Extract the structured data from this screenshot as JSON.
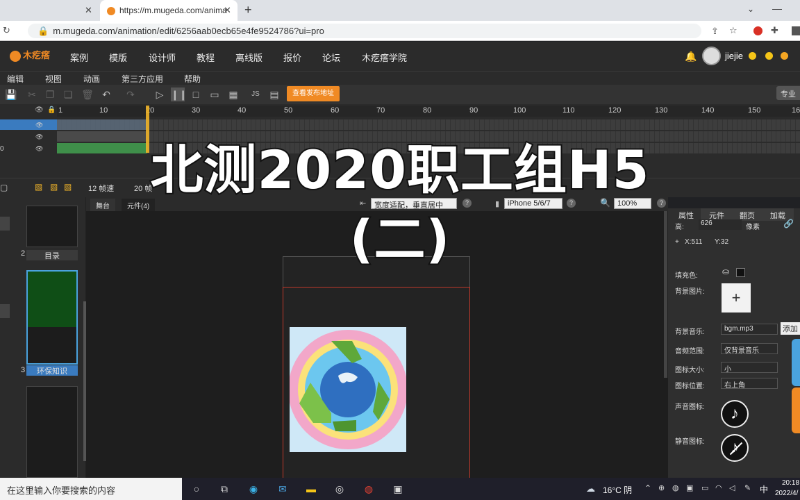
{
  "browser": {
    "tab_partial": "",
    "tab_active_title": "https://m.mugeda.com/anima",
    "new_tab_label": "+",
    "url": "m.mugeda.com/animation/edit/6256aab0ecb65e4fe9524786?ui=pro"
  },
  "site_nav": {
    "logo_text": "木疙瘩",
    "items": [
      "案例",
      "模版",
      "设计师",
      "教程",
      "离线版",
      "报价",
      "论坛",
      "木疙瘩学院"
    ],
    "username": "jiejie"
  },
  "menu": [
    "编辑",
    "视图",
    "动画",
    "第三方应用",
    "帮助"
  ],
  "toolbar": {
    "publish_label": "查看发布地址",
    "pro_label": "专业"
  },
  "timeline": {
    "ticks": [
      "1",
      "10",
      "20",
      "30",
      "40",
      "50",
      "60",
      "70",
      "80",
      "90",
      "100",
      "110",
      "120",
      "130",
      "140",
      "150",
      "16"
    ],
    "layer_num": "0"
  },
  "framebar": {
    "fps_label": "12 帧速",
    "frame_label": "20 帧"
  },
  "pages": [
    {
      "num": "2",
      "label": "目录"
    },
    {
      "num": "3",
      "label": "环保知识"
    }
  ],
  "stage": {
    "tabs": [
      "舞台",
      "元件(4)"
    ],
    "fit_select": "宽度适配，垂直居中",
    "device_select": "iPhone 5/6/7",
    "zoom_select": "100%"
  },
  "overlay": {
    "line1": "北测2020职工组H5",
    "line2": "(二)"
  },
  "right_panel": {
    "tabs": [
      "属性",
      "元件",
      "翻页",
      "加载"
    ],
    "height_label": "高:",
    "height_value": "626",
    "unit": "像素",
    "coord_x": "X:511",
    "coord_y": "Y:32",
    "fill_label": "填充色:",
    "bgimg_label": "背景图片:",
    "bgmusic_label": "背景音乐:",
    "bgmusic_value": "bgm.mp3",
    "add_label": "添加",
    "range_label": "音频范围:",
    "range_value": "仅背景音乐",
    "iconsize_label": "图标大小:",
    "iconsize_value": "小",
    "iconpos_label": "图标位置:",
    "iconpos_value": "右上角",
    "sound_icon_label": "声音图标:",
    "mute_icon_label": "静音图标:"
  },
  "taskbar": {
    "search_placeholder": "在这里输入你要搜索的内容",
    "weather": "16°C 阴",
    "ime": "中",
    "time": "20:18",
    "date": "2022/4/"
  }
}
